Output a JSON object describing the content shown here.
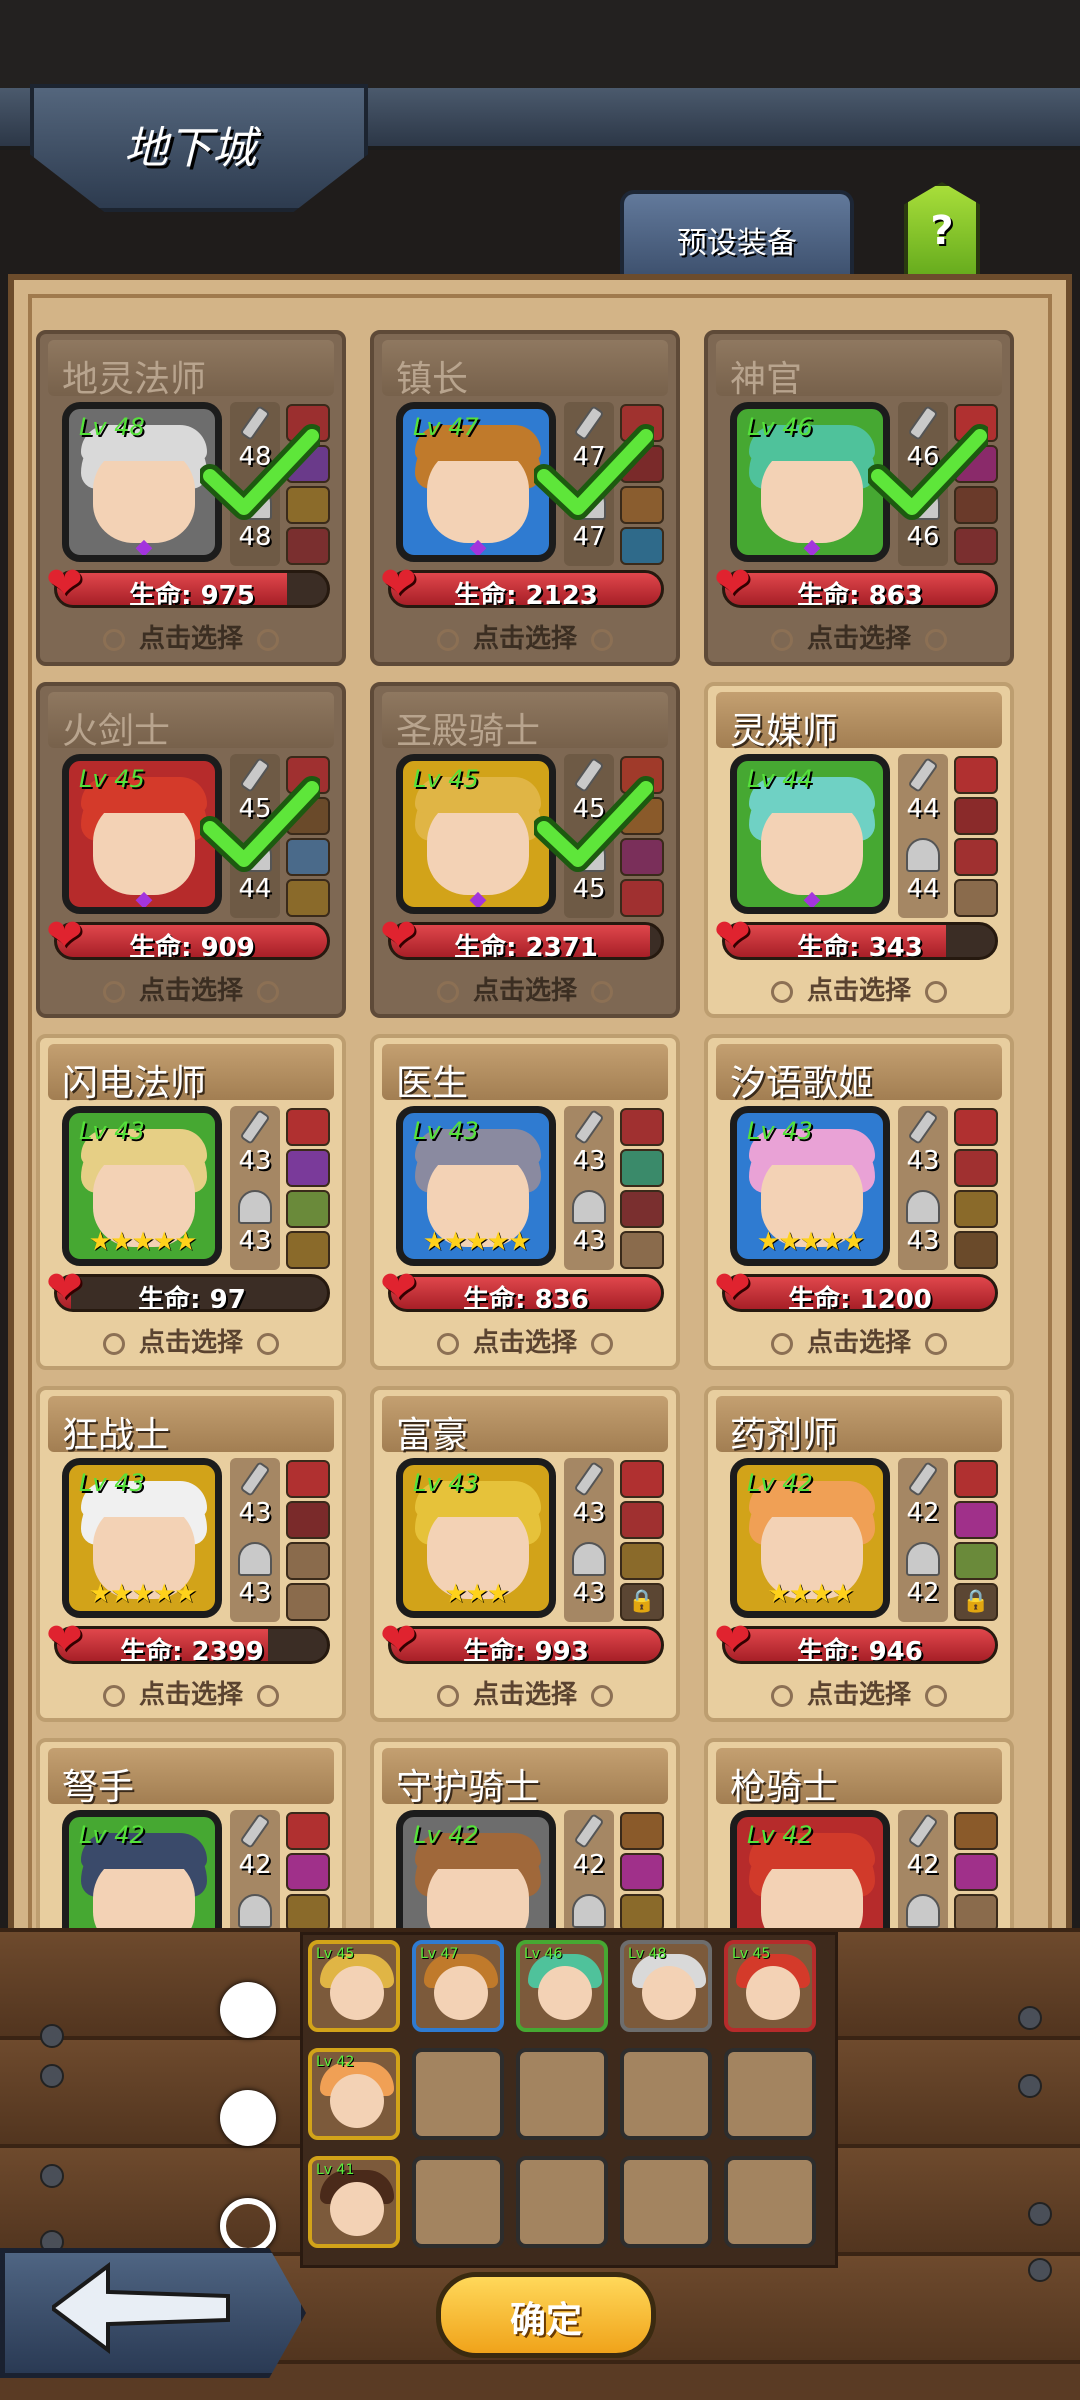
{
  "header": {
    "title": "地下城",
    "preset_tab": "预设装备",
    "help": "?"
  },
  "heroes": [
    {
      "name": "地灵法师",
      "level": "Lv 48",
      "atk": "48",
      "def": "48",
      "hp": "生命: 975",
      "hp_ratio": 0.85,
      "select": "点击选择",
      "selected": true,
      "hair": "#d9d9d9",
      "frame": "#6d6d6d",
      "stars": "",
      "equip": [
        "#9b2f2f",
        "#6a3a8a",
        "#8b6b2a",
        "#7a2f2f"
      ]
    },
    {
      "name": "镇长",
      "level": "Lv 47",
      "atk": "47",
      "def": "47",
      "hp": "生命: 2123",
      "hp_ratio": 1,
      "select": "点击选择",
      "selected": true,
      "hair": "#c07a2b",
      "frame": "#2f7bd1",
      "stars": "",
      "equip": [
        "#a0322f",
        "#7a2a2a",
        "#8a5d2f",
        "#2f6a8a"
      ]
    },
    {
      "name": "神官",
      "level": "Lv 46",
      "atk": "46",
      "def": "46",
      "hp": "生命: 863",
      "hp_ratio": 1,
      "select": "点击选择",
      "selected": true,
      "hair": "#4fc29b",
      "frame": "#46a832",
      "stars": "",
      "equip": [
        "#b03030",
        "#8a2a6a",
        "#6a3a2a",
        "#7a2f2f"
      ]
    },
    {
      "name": "火剑士",
      "level": "Lv 45",
      "atk": "45",
      "def": "44",
      "hp": "生命: 909",
      "hp_ratio": 1,
      "select": "点击选择",
      "selected": true,
      "hair": "#d43a2a",
      "frame": "#b62b2b",
      "stars": "",
      "equip": [
        "#a03030",
        "#6a4a2a",
        "#4a6a8a",
        "#8a6a2a"
      ]
    },
    {
      "name": "圣殿骑士",
      "level": "Lv 45",
      "atk": "45",
      "def": "45",
      "hp": "生命: 2371",
      "hp_ratio": 0.96,
      "select": "点击选择",
      "selected": true,
      "hair": "#e0b545",
      "frame": "#d2a319",
      "stars": "",
      "equip": [
        "#a03a2a",
        "#8a5a2a",
        "#7a2f5a",
        "#a03030"
      ]
    },
    {
      "name": "灵媒师",
      "level": "Lv 44",
      "atk": "44",
      "def": "44",
      "hp": "生命: 343",
      "hp_ratio": 0.82,
      "select": "点击选择",
      "selected": false,
      "hair": "#6fd1c4",
      "frame": "#46a832",
      "stars": "",
      "equip": [
        "#b03030",
        "#8a2a2a",
        "#a03030",
        "empty"
      ]
    },
    {
      "name": "闪电法师",
      "level": "Lv 43",
      "atk": "43",
      "def": "43",
      "hp": "生命: 97",
      "hp_ratio": 0.05,
      "select": "点击选择",
      "selected": false,
      "hair": "#e6cf85",
      "frame": "#46a832",
      "stars": "★★★★★",
      "equip": [
        "#b03030",
        "#7a3a9a",
        "#6a8a3a",
        "#8a6a2a"
      ]
    },
    {
      "name": "医生",
      "level": "Lv 43",
      "atk": "43",
      "def": "43",
      "hp": "生命: 836",
      "hp_ratio": 1,
      "select": "点击选择",
      "selected": false,
      "hair": "#8a8aa0",
      "frame": "#2f7bd1",
      "stars": "★★★★★",
      "equip": [
        "#a03030",
        "#3a8a6a",
        "#7a2f2f",
        "empty"
      ]
    },
    {
      "name": "汐语歌姬",
      "level": "Lv 43",
      "atk": "43",
      "def": "43",
      "hp": "生命: 1200",
      "hp_ratio": 1,
      "select": "点击选择",
      "selected": false,
      "hair": "#e9a2d6",
      "frame": "#2f7bd1",
      "stars": "★★★★★",
      "equip": [
        "#b03030",
        "#a03030",
        "#8a6a2a",
        "#6a4a2a"
      ]
    },
    {
      "name": "狂战士",
      "level": "Lv 43",
      "atk": "43",
      "def": "43",
      "hp": "生命: 2399",
      "hp_ratio": 0.78,
      "select": "点击选择",
      "selected": false,
      "hair": "#f0f0f0",
      "frame": "#d2a319",
      "stars": "★★★★★",
      "equip": [
        "#b03030",
        "#7a2a2a",
        "empty",
        "empty"
      ]
    },
    {
      "name": "富豪",
      "level": "Lv 43",
      "atk": "43",
      "def": "43",
      "hp": "生命: 993",
      "hp_ratio": 1,
      "select": "点击选择",
      "selected": false,
      "hair": "#e6c23a",
      "frame": "#d2a319",
      "stars": "★★★",
      "equip": [
        "#b03030",
        "#a03030",
        "#8a6a2a",
        "lock"
      ]
    },
    {
      "name": "药剂师",
      "level": "Lv 42",
      "atk": "42",
      "def": "42",
      "hp": "生命: 946",
      "hp_ratio": 1,
      "select": "点击选择",
      "selected": false,
      "hair": "#f0a055",
      "frame": "#d2a319",
      "stars": "★★★★",
      "equip": [
        "#b03030",
        "#a0308a",
        "#6a8a3a",
        "lock"
      ]
    },
    {
      "name": "弩手",
      "level": "Lv 42",
      "atk": "42",
      "def": "",
      "hp": "",
      "hp_ratio": 1,
      "select": "",
      "selected": false,
      "hair": "#3a4a6a",
      "frame": "#46a832",
      "stars": "",
      "equip": [
        "#b03030",
        "#a0308a",
        "#8a6a2a",
        "empty"
      ]
    },
    {
      "name": "守护骑士",
      "level": "Lv 42",
      "atk": "42",
      "def": "",
      "hp": "",
      "hp_ratio": 1,
      "select": "",
      "selected": false,
      "hair": "#a0683a",
      "frame": "#6d6d6d",
      "stars": "",
      "equip": [
        "#8a5a2a",
        "#a0308a",
        "#8a6a2a",
        "empty"
      ]
    },
    {
      "name": "枪骑士",
      "level": "Lv 42",
      "atk": "42",
      "def": "",
      "hp": "",
      "hp_ratio": 1,
      "select": "",
      "selected": false,
      "hair": "#d13a2a",
      "frame": "#b62b2b",
      "stars": "",
      "equip": [
        "#8a5a2a",
        "#a0308a",
        "empty",
        "empty"
      ]
    }
  ],
  "teams": [
    {
      "active": true,
      "slots": [
        {
          "level": "Lv 45",
          "hair": "#e0b545",
          "frame": "#d2a319"
        },
        {
          "level": "Lv 47",
          "hair": "#c07a2b",
          "frame": "#2f7bd1"
        },
        {
          "level": "Lv 46",
          "hair": "#4fc29b",
          "frame": "#46a832"
        },
        {
          "level": "Lv 48",
          "hair": "#d9d9d9",
          "frame": "#6d6d6d"
        },
        {
          "level": "Lv 45",
          "hair": "#d43a2a",
          "frame": "#b62b2b"
        }
      ]
    },
    {
      "active": false,
      "slots": [
        {
          "level": "Lv 42",
          "hair": "#f0a055",
          "frame": "#d2a319"
        },
        null,
        null,
        null,
        null
      ]
    },
    {
      "active": false,
      "slots": [
        {
          "level": "Lv 41",
          "hair": "#4a2a1a",
          "frame": "#d2a319"
        },
        null,
        null,
        null,
        null
      ]
    }
  ],
  "footer": {
    "confirm": "确定"
  }
}
